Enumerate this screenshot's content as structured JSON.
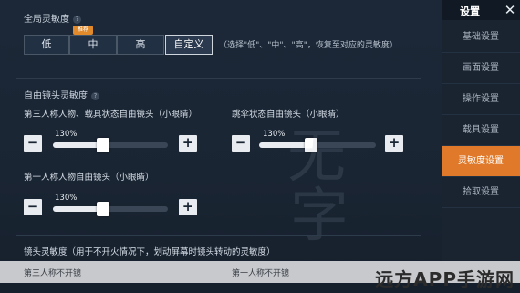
{
  "global": {
    "title": "全局灵敏度",
    "info_icon": "?",
    "options": [
      "低",
      "中",
      "高",
      "自定义"
    ],
    "selected": "自定义",
    "recommend_badge": "推荐",
    "hint": "（选择\"低\"、\"中\"、\"高\"，恢复至对应的灵敏度）"
  },
  "free_cam": {
    "title": "自由镜头灵敏度",
    "info_icon": "?",
    "sliders": [
      {
        "label": "第三人称人物、载具状态自由镜头（小眼睛）",
        "value_text": "130%",
        "value": 130
      },
      {
        "label": "跳伞状态自由镜头（小眼睛）",
        "value_text": "130%",
        "value": 130
      },
      {
        "label": "第一人称人物自由镜头（小眼睛）",
        "value_text": "130%",
        "value": 130
      }
    ],
    "minus": "−",
    "plus": "+"
  },
  "lens": {
    "title": "镜头灵敏度（用于不开火情况下，划动屏幕时镜头转动的灵敏度）",
    "row_left": "第三人称不开镜",
    "row_right": "第一人称不开镜"
  },
  "nav": {
    "title": "设置",
    "close": "✕",
    "items": [
      "基础设置",
      "画面设置",
      "操作设置",
      "载具设置",
      "灵敏度设置",
      "拾取设置"
    ],
    "active": "灵敏度设置"
  },
  "watermark": "远方APP手游网",
  "decor": {
    "brush_1": "无",
    "brush_2": "字"
  },
  "colors": {
    "accent": "#e07a2a",
    "background": "#1b2735"
  }
}
